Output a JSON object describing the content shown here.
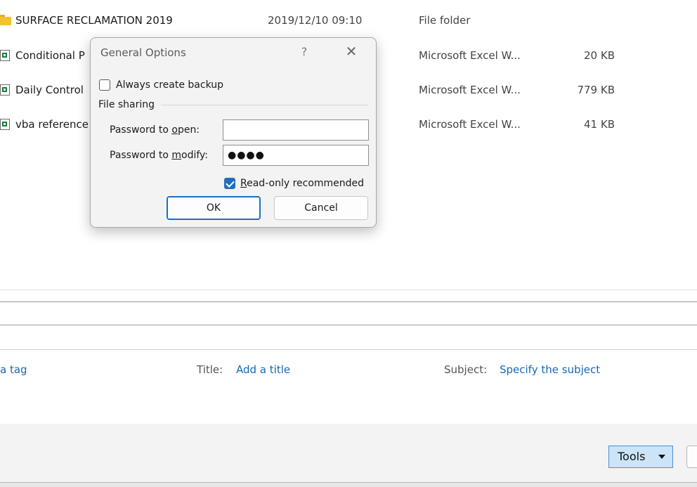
{
  "files": [
    {
      "name": "SURFACE RECLAMATION 2019",
      "date": "2019/12/10 09:10",
      "type": "File folder",
      "size": "",
      "icon": "folder-icon"
    },
    {
      "name": "Conditional P",
      "date": "",
      "type": "Microsoft Excel W...",
      "size": "20 KB",
      "icon": "excel-file-icon"
    },
    {
      "name": "Daily Control",
      "date": "",
      "type": "Microsoft Excel W...",
      "size": "779 KB",
      "icon": "excel-file-icon"
    },
    {
      "name": "vba reference",
      "date": "",
      "type": "Microsoft Excel W...",
      "size": "41 KB",
      "icon": "excel-file-icon"
    }
  ],
  "dialog": {
    "title": "General Options",
    "help_glyph": "?",
    "close_glyph": "✕",
    "always_backup_label": "Always create backup",
    "always_backup_checked": false,
    "file_sharing_label": "File sharing",
    "password_open_label": "Password to open:",
    "password_open_value": "",
    "password_modify_label": "Password to modify:",
    "password_modify_value": "●●●●",
    "read_only_label": "Read-only recommended",
    "read_only_checked": true,
    "ok_label": "OK",
    "cancel_label": "Cancel",
    "accent_color": "#1f6ec0"
  },
  "metadata": {
    "tags_link": "a tag",
    "title_label": "Title:",
    "title_link": "Add a title",
    "subject_label": "Subject:",
    "subject_link": "Specify the subject",
    "link_color": "#1668b8"
  },
  "footer": {
    "tools_label": "Tools"
  }
}
